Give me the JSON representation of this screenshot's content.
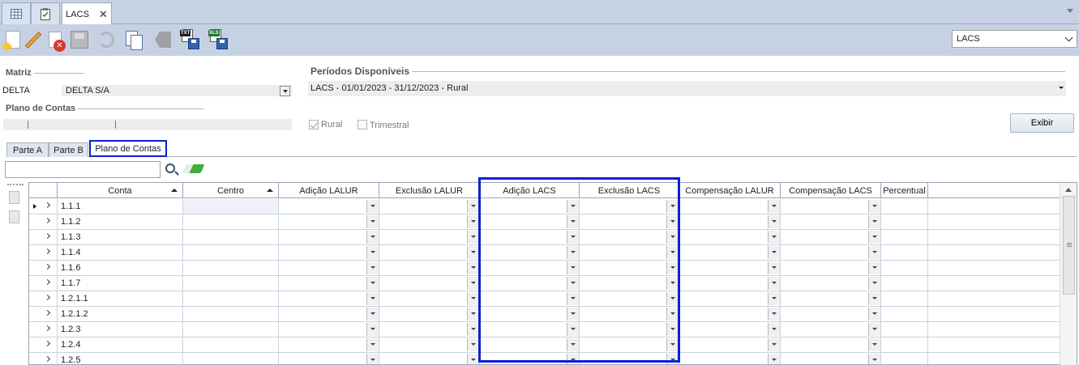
{
  "document_tabs": [
    {
      "icon": "grid-icon",
      "label": ""
    },
    {
      "icon": "clipboard-icon",
      "label": ""
    },
    {
      "icon": "",
      "label": "LACS",
      "close": "✕"
    }
  ],
  "toolbar": {
    "buttons": [
      "new-icon",
      "edit-icon",
      "delete-icon",
      "save-icon",
      "undo-icon",
      "copy-icon",
      "tag-icon",
      "export-txt-icon",
      "export-xls-icon"
    ],
    "export_txt_tag": "TXT",
    "export_xls_tag": "XLS"
  },
  "view_select": {
    "value": "LACS"
  },
  "matriz": {
    "title": "Matriz",
    "code": "DELTA",
    "name": "DELTA S/A"
  },
  "plano_de_contas": {
    "title": "Plano de Contas",
    "value": ""
  },
  "periodos": {
    "title": "Períodos Disponíveis",
    "value": "LACS - 01/01/2023 - 31/12/2023 - Rural"
  },
  "checkboxes": {
    "rural": {
      "label": "Rural",
      "checked": true
    },
    "trimestral": {
      "label": "Trimestral",
      "checked": false
    }
  },
  "exibir_label": "Exibir",
  "inner_tabs": [
    "Parte A",
    "Parte B",
    "Plano de Contas"
  ],
  "search": {
    "value": ""
  },
  "grid": {
    "columns": [
      "Conta",
      "Centro",
      "Adição LALUR",
      "Exclusão LALUR",
      "Adição LACS",
      "Exclusão LACS",
      "Compensação LALUR",
      "Compensação LACS",
      "Percentual"
    ],
    "rows": [
      "1.1.1",
      "1.1.2",
      "1.1.3",
      "1.1.4",
      "1.1.6",
      "1.1.7",
      "1.2.1.1",
      "1.2.1.2",
      "1.2.3",
      "1.2.4",
      "1.2.5"
    ]
  },
  "colors": {
    "highlight": "#0a1fd6",
    "chrome": "#c6d2e4"
  }
}
